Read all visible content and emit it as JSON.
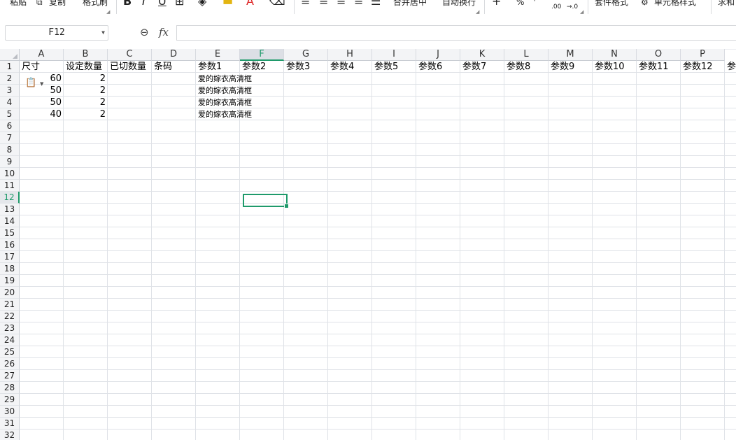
{
  "ribbon": {
    "paste": "粘贴",
    "copy": "复制",
    "format_painter": "格式刷",
    "bold": "B",
    "italic": "I",
    "underline": "U",
    "merge_center": "合并居中",
    "wrap_text": "自动换行",
    "percent": "%",
    "dec_increase": ".00",
    "dec_decrease": "→.0",
    "table_format": "套件格式",
    "cell_style": "单元格样式",
    "sum": "求和"
  },
  "formula_bar": {
    "name_box": "F12",
    "fx": "fx",
    "formula": ""
  },
  "columns": [
    "A",
    "B",
    "C",
    "D",
    "E",
    "F",
    "G",
    "H",
    "I",
    "J",
    "K",
    "L",
    "M",
    "N",
    "O",
    "P"
  ],
  "active_column": "F",
  "rows": [
    "1",
    "2",
    "3",
    "4",
    "5",
    "6",
    "7",
    "8",
    "9",
    "10",
    "11",
    "12",
    "13",
    "14",
    "15",
    "16",
    "17",
    "18",
    "19",
    "20",
    "21",
    "22",
    "23",
    "24",
    "25",
    "26",
    "27",
    "28",
    "29",
    "30",
    "31",
    "32"
  ],
  "active_row": "12",
  "header_row": [
    "尺寸",
    "设定数量",
    "已切数量",
    "条码",
    "参数1",
    "参数2",
    "参数3",
    "参数4",
    "参数5",
    "参数6",
    "参数7",
    "参数8",
    "参数9",
    "参数10",
    "参数11",
    "参数12",
    "参"
  ],
  "data_rows": [
    {
      "size": "60",
      "qty": "2",
      "param1": "爱的嫁衣高清框"
    },
    {
      "size": "50",
      "qty": "2",
      "param1": "爱的嫁衣高清框"
    },
    {
      "size": "50",
      "qty": "2",
      "param1": "爱的嫁衣高清框"
    },
    {
      "size": "40",
      "qty": "2",
      "param1": "爱的嫁衣高清框"
    }
  ],
  "selected_cell": "F12"
}
